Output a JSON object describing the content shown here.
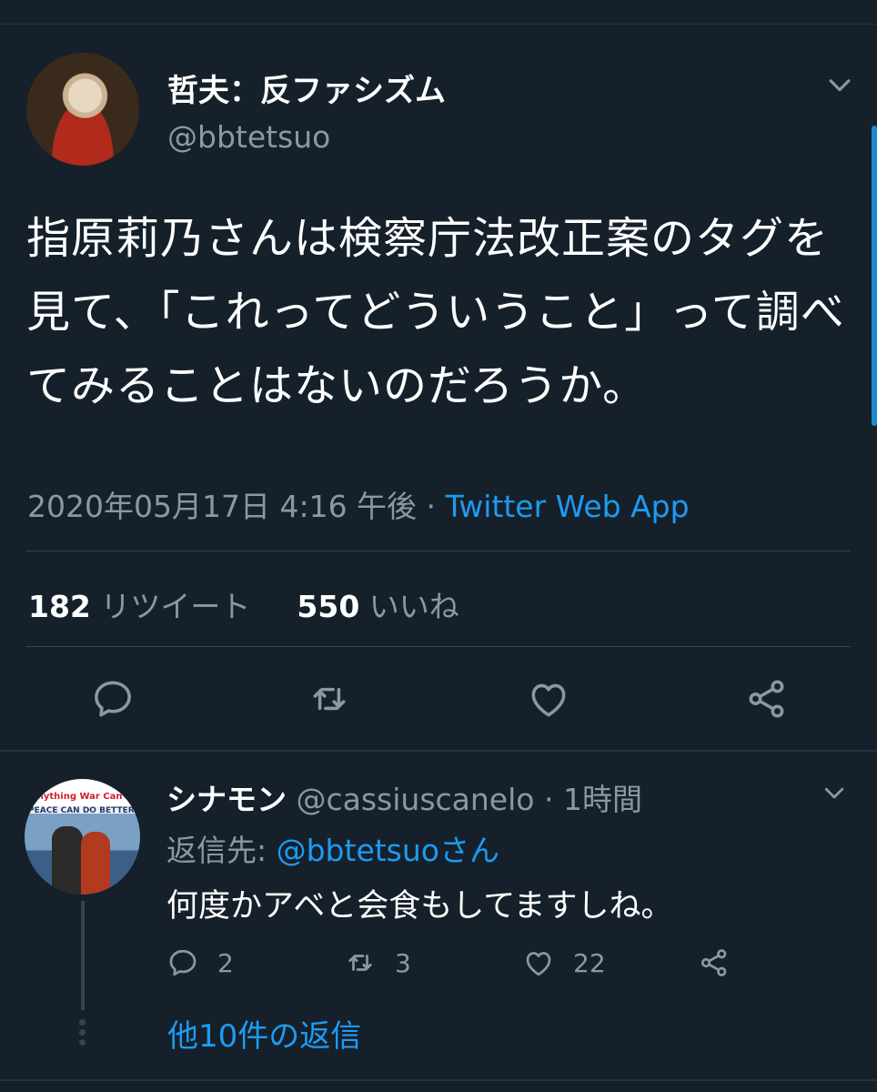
{
  "tweet": {
    "display_name": "哲夫：反ファシズム",
    "handle": "@bbtetsuo",
    "text": "指原莉乃さんは検察庁法改正案のタグを見て、「これってどういうこと」って調べてみることはないのだろうか。",
    "timestamp": "2020年05月17日 4:16 午後",
    "separator": " · ",
    "source": "Twitter Web App",
    "retweet_count": "182",
    "retweet_label": "リツイート",
    "like_count": "550",
    "like_label": "いいね"
  },
  "reply": {
    "display_name": "シナモン",
    "handle": "@cassiuscanelo",
    "time": "1時間",
    "separator": " · ",
    "replying_to_label": "返信先: ",
    "replying_to_user": "@bbtetsuoさん",
    "text": "何度かアベと会食もしてますしね。",
    "reply_count": "2",
    "retweet_count": "3",
    "like_count": "22",
    "avatar_text_top": "Anything War Can Do",
    "avatar_text_bottom": "PEACE CAN DO BETTER"
  },
  "more_replies": "他10件の返信",
  "icons": {
    "reply": "reply-icon",
    "retweet": "retweet-icon",
    "like": "heart-icon",
    "share": "share-icon",
    "menu": "chevron-down-icon"
  },
  "colors": {
    "background": "#15202b",
    "accent": "#1d9bf0",
    "muted": "#8899a6",
    "divider": "#38444d"
  }
}
